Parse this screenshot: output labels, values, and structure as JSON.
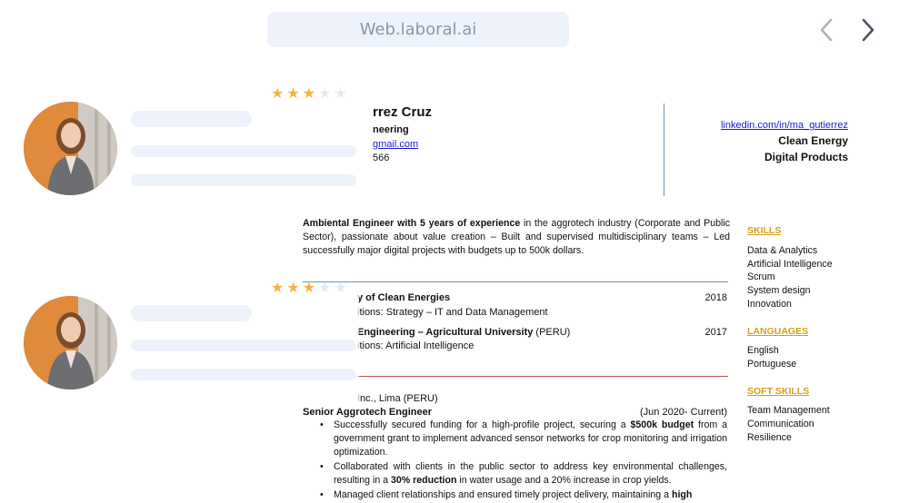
{
  "browser": {
    "url": "Web.laboral.ai",
    "prev_icon": "chevron-left-icon",
    "next_icon": "chevron-right-icon"
  },
  "candidates": [
    {
      "rating": 3,
      "max_rating": 5
    },
    {
      "rating": 3,
      "max_rating": 5
    }
  ],
  "resume": {
    "name_fragment": "rrez Cruz",
    "field_fragment": "neering",
    "email_fragment": "gmail.com",
    "phone_fragment": "566",
    "linkedin": "linkedin.com/in/ma_gutierrez",
    "focus_1": "Clean Energy",
    "focus_2": "Digital Products",
    "summary_bold": "Ambiental Engineer with 5 years of experience",
    "summary_rest": " in the aggrotech industry (Corporate and Public Sector), passionate about value creation – Built and supervised multidisciplinary teams – Led successfully major digital projects with budgets up to 500k dollars.",
    "education": [
      {
        "title_fragment": "y of Clean Energies",
        "year": "2018",
        "detail_fragment": "itions:  Strategy – IT and Data Management"
      },
      {
        "title_fragment": "Engineering – Agricultural University",
        "title_suffix": " (PERU)",
        "year": "2017",
        "detail_fragment": "itions:  Artificial Intelligence"
      }
    ],
    "company_fragment": "Inc., Lima (PERU)",
    "role": "Senior Aggrotech Engineer",
    "role_dates": "(Jun 2020- Current)",
    "bullets": [
      {
        "pre": "Successfully secured funding for a high-profile project, securing a ",
        "bold": "$500k budget",
        "post": " from a government grant to implement advanced sensor networks for crop monitoring and irrigation optimization."
      },
      {
        "pre": "Collaborated with clients in the public sector to address key environmental challenges, resulting in a ",
        "bold": "30% reduction",
        "post": " in water usage and a 20% increase in crop yields."
      },
      {
        "pre": "Managed client relationships and ensured timely project delivery, maintaining a ",
        "bold": "high",
        "post": ""
      }
    ],
    "skills_title": "SKILLS",
    "skills": [
      "Data & Analytics",
      "Artificial Intelligence",
      "Scrum",
      "System design",
      "Innovation"
    ],
    "languages_title": "LANGUAGES",
    "languages": [
      "English",
      "Portuguese"
    ],
    "soft_title": "SOFT SKILLS",
    "soft_skills": [
      "Team Management",
      "Communication",
      "Resilience"
    ],
    "colors": {
      "accent": "#d4a017",
      "link": "#1a1ad6",
      "star": "#f4b43a"
    }
  }
}
